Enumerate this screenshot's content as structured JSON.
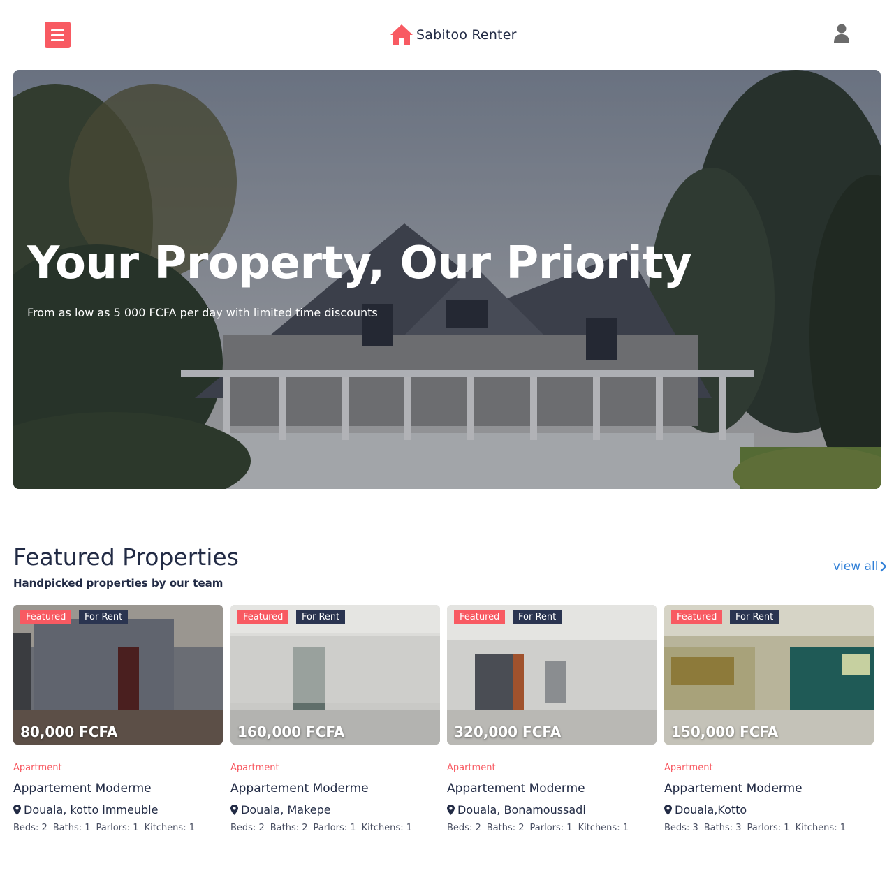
{
  "header": {
    "brand": "Sabitoo Renter",
    "menu_icon": "hamburger-icon",
    "brand_icon": "home-icon",
    "user_icon": "user-icon",
    "accent": "#f85a62"
  },
  "hero": {
    "title": "Your Property, Our Priority",
    "subtitle": "From as low as 5 000 FCFA per day with limited time discounts"
  },
  "featured": {
    "title": "Featured Properties",
    "subtitle": "Handpicked properties by our team",
    "view_all": "view all",
    "cards": [
      {
        "badge_featured": "Featured",
        "badge_status": "For Rent",
        "price": "80,000 FCFA",
        "type": "Apartment",
        "name": "Appartement Moderme",
        "location": "Douala, kotto immeuble",
        "beds": "Beds: 2",
        "baths": "Baths: 1",
        "parlors": "Parlors: 1",
        "kitchens": "Kitchens: 1"
      },
      {
        "badge_featured": "Featured",
        "badge_status": "For Rent",
        "price": "160,000 FCFA",
        "type": "Apartment",
        "name": "Appartement Moderme",
        "location": "Douala, Makepe",
        "beds": "Beds: 2",
        "baths": "Baths: 2",
        "parlors": "Parlors: 1",
        "kitchens": "Kitchens: 1"
      },
      {
        "badge_featured": "Featured",
        "badge_status": "For Rent",
        "price": "320,000 FCFA",
        "type": "Apartment",
        "name": "Appartement Moderme",
        "location": "Douala, Bonamoussadi",
        "beds": "Beds: 2",
        "baths": "Baths: 2",
        "parlors": "Parlors: 1",
        "kitchens": "Kitchens: 1"
      },
      {
        "badge_featured": "Featured",
        "badge_status": "For Rent",
        "price": "150,000 FCFA",
        "type": "Apartment",
        "name": "Appartement Moderme",
        "location": "Douala,Kotto",
        "beds": "Beds: 3",
        "baths": "Baths: 3",
        "parlors": "Parlors: 1",
        "kitchens": "Kitchens: 1"
      }
    ]
  }
}
